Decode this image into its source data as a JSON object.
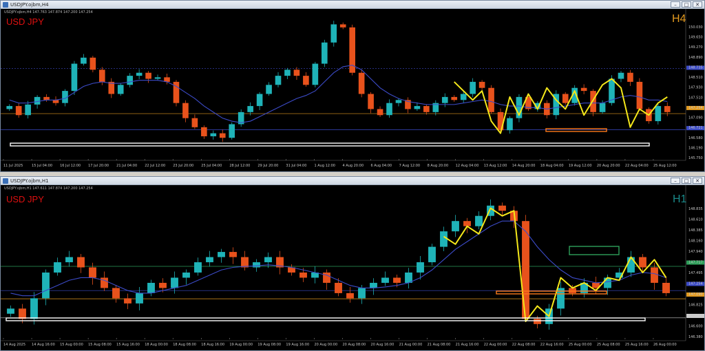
{
  "colors": {
    "bull": "#1fb3b8",
    "bear": "#e8521c",
    "ma": "#3c4bc8",
    "zigzag": "#f5e81a",
    "orange_box": "#ff7b1a",
    "green_box": "#2ea05a",
    "white_box": "#ffffff",
    "symbol": "#e01010",
    "tf_h4": "#e39a1f",
    "tf_h1": "#1a8a8a"
  },
  "top": {
    "title": "USDJPY.ojbm,H4",
    "ohlc_text": "USDJPY.ojbm,H4  147.763 147.874 147.200 147.254",
    "symbol": "USD JPY",
    "timeframe": "H4",
    "price_ticks": [
      "150.030",
      "149.650",
      "149.270",
      "148.890",
      "148.735",
      "148.510",
      "147.930",
      "147.510",
      "147.254",
      "147.090",
      "146.721",
      "146.580",
      "146.190",
      "145.750"
    ],
    "price_range": [
      145.75,
      150.3
    ],
    "time_ticks": [
      "11 Jul 2025",
      "15 Jul 04:00",
      "16 Jul 12:00",
      "17 Jul 20:00",
      "21 Jul 04:00",
      "22 Jul 12:00",
      "23 Jul 20:00",
      "25 Jul 04:00",
      "28 Jul 12:00",
      "29 Jul 20:00",
      "31 Jul 04:00",
      "1 Aug 12:00",
      "4 Aug 20:00",
      "6 Aug 04:00",
      "7 Aug 12:00",
      "8 Aug 20:00",
      "12 Aug 04:00",
      "13 Aug 12:00",
      "14 Aug 20:00",
      "18 Aug 04:00",
      "19 Aug 12:00",
      "20 Aug 20:00",
      "22 Aug 04:00",
      "25 Aug 12:00"
    ],
    "closes": [
      147.5,
      147.2,
      147.55,
      147.8,
      147.7,
      147.6,
      148.0,
      148.9,
      149.1,
      148.7,
      148.3,
      147.9,
      148.2,
      148.5,
      148.6,
      148.4,
      148.45,
      148.3,
      147.6,
      147.1,
      146.8,
      146.5,
      146.6,
      146.45,
      146.9,
      147.3,
      147.5,
      147.9,
      148.2,
      148.5,
      148.7,
      148.5,
      148.2,
      148.9,
      149.6,
      150.2,
      150.1,
      148.6,
      147.9,
      147.4,
      147.2,
      147.6,
      147.7,
      147.4,
      147.5,
      147.3,
      147.6,
      147.8,
      147.7,
      147.9,
      148.3,
      148.1,
      147.3,
      146.7,
      147.1,
      147.8,
      147.4,
      147.6,
      147.2,
      147.9,
      147.6,
      148.1,
      148.0,
      147.3,
      147.6,
      148.4,
      148.6,
      148.3,
      147.4,
      147.0,
      147.5,
      147.3
    ],
    "ma": [
      147.7,
      147.6,
      147.6,
      147.65,
      147.7,
      147.7,
      147.75,
      147.95,
      148.15,
      148.25,
      148.3,
      148.25,
      148.25,
      148.3,
      148.35,
      148.35,
      148.35,
      148.3,
      148.15,
      147.95,
      147.75,
      147.5,
      147.3,
      147.1,
      147.0,
      146.95,
      147.0,
      147.15,
      147.3,
      147.45,
      147.6,
      147.75,
      147.85,
      148.0,
      148.3,
      148.6,
      148.8,
      148.85,
      148.7,
      148.4,
      148.1,
      147.9,
      147.75,
      147.65,
      147.6,
      147.55,
      147.55,
      147.55,
      147.55,
      147.6,
      147.65,
      147.7,
      147.65,
      147.55,
      147.5,
      147.5,
      147.45,
      147.45,
      147.4,
      147.45,
      147.5,
      147.55,
      147.6,
      147.6,
      147.6,
      147.7,
      147.8,
      147.85,
      147.8,
      147.7,
      147.7,
      147.65
    ],
    "zigzag": [
      [
        48,
        148.3
      ],
      [
        50,
        147.7
      ],
      [
        51,
        148.0
      ],
      [
        52,
        147.0
      ],
      [
        53,
        146.6
      ],
      [
        54,
        147.8
      ],
      [
        55,
        147.2
      ],
      [
        56,
        147.9
      ],
      [
        57,
        147.4
      ],
      [
        58,
        148.1
      ],
      [
        59,
        147.7
      ],
      [
        60,
        147.4
      ],
      [
        61,
        148.0
      ],
      [
        62,
        147.2
      ],
      [
        63,
        147.7
      ],
      [
        64,
        148.2
      ],
      [
        65,
        148.4
      ],
      [
        66,
        148.1
      ],
      [
        67,
        146.8
      ],
      [
        68,
        147.4
      ],
      [
        69,
        147.2
      ],
      [
        70,
        147.6
      ],
      [
        71,
        147.8
      ]
    ],
    "h_levels": [
      {
        "price": 148.74,
        "color": "#3c4bc8",
        "dashed": true
      },
      {
        "price": 147.25,
        "color": "#e39a1f",
        "dashed": false
      },
      {
        "price": 146.72,
        "color": "#3c4bc8",
        "dashed": false
      }
    ]
  },
  "bottom": {
    "title": "USDJPY.ojbm,H1",
    "ohlc_text": "USDJPY.ojbm,H1  147.611 147.874 147.200 147.254",
    "symbol": "USD JPY",
    "timeframe": "H1",
    "price_ticks": [
      "148.835",
      "148.610",
      "148.385",
      "148.160",
      "147.940",
      "147.717",
      "147.495",
      "147.254",
      "147.090",
      "146.825",
      "146.721",
      "146.600",
      "146.380"
    ],
    "price_range": [
      146.33,
      148.95
    ],
    "time_ticks": [
      "14 Aug 2025",
      "14 Aug 16:00",
      "15 Aug 00:00",
      "15 Aug 08:00",
      "15 Aug 16:00",
      "18 Aug 00:00",
      "18 Aug 08:00",
      "18 Aug 16:00",
      "19 Aug 00:00",
      "19 Aug 08:00",
      "19 Aug 16:00",
      "20 Aug 00:00",
      "20 Aug 08:00",
      "20 Aug 16:00",
      "21 Aug 00:00",
      "21 Aug 08:00",
      "21 Aug 16:00",
      "22 Aug 00:00",
      "22 Aug 08:00",
      "22 Aug 16:00",
      "25 Aug 00:00",
      "25 Aug 08:00",
      "25 Aug 16:00",
      "26 Aug 00:00"
    ],
    "closes": [
      146.9,
      146.7,
      147.1,
      147.6,
      147.8,
      147.9,
      147.7,
      147.5,
      147.3,
      147.1,
      147.0,
      147.2,
      147.4,
      147.3,
      147.5,
      147.6,
      147.8,
      147.9,
      148.0,
      147.9,
      147.7,
      147.8,
      147.9,
      147.7,
      147.6,
      147.5,
      147.6,
      147.4,
      147.2,
      147.1,
      147.3,
      147.4,
      147.5,
      147.4,
      147.6,
      147.8,
      148.1,
      148.4,
      148.6,
      148.5,
      148.7,
      148.9,
      148.8,
      148.6,
      146.7,
      146.6,
      146.9,
      147.3,
      147.2,
      147.4,
      147.3,
      147.5,
      147.6,
      147.9,
      147.7,
      147.4,
      147.2
    ],
    "ma": [
      147.2,
      147.15,
      147.15,
      147.25,
      147.35,
      147.45,
      147.5,
      147.5,
      147.45,
      147.35,
      147.25,
      147.2,
      147.2,
      147.25,
      147.3,
      147.35,
      147.45,
      147.55,
      147.65,
      147.7,
      147.72,
      147.73,
      147.75,
      147.73,
      147.7,
      147.65,
      147.6,
      147.55,
      147.45,
      147.35,
      147.3,
      147.3,
      147.32,
      147.35,
      147.4,
      147.5,
      147.65,
      147.85,
      148.05,
      148.2,
      148.35,
      148.5,
      148.6,
      148.6,
      148.4,
      148.1,
      147.85,
      147.65,
      147.5,
      147.45,
      147.4,
      147.42,
      147.45,
      147.55,
      147.6,
      147.58,
      147.5
    ],
    "zigzag": [
      [
        37,
        148.3
      ],
      [
        38,
        148.15
      ],
      [
        39,
        148.5
      ],
      [
        40,
        148.35
      ],
      [
        41,
        148.85
      ],
      [
        42,
        148.7
      ],
      [
        43,
        148.8
      ],
      [
        44,
        146.65
      ],
      [
        45,
        146.95
      ],
      [
        46,
        146.75
      ],
      [
        47,
        147.5
      ],
      [
        48,
        147.3
      ],
      [
        49,
        147.4
      ],
      [
        50,
        147.25
      ],
      [
        51,
        147.5
      ],
      [
        52,
        147.45
      ],
      [
        53,
        147.9
      ],
      [
        54,
        147.6
      ],
      [
        55,
        147.85
      ],
      [
        56,
        147.5
      ]
    ],
    "h_levels": [
      {
        "price": 147.72,
        "color": "#2ea05a",
        "dashed": false
      },
      {
        "price": 147.25,
        "color": "#3c4bc8",
        "dashed": false
      },
      {
        "price": 147.09,
        "color": "#e39a1f",
        "dashed": false
      },
      {
        "price": 146.72,
        "color": "#cccccc",
        "dashed": false
      }
    ]
  }
}
